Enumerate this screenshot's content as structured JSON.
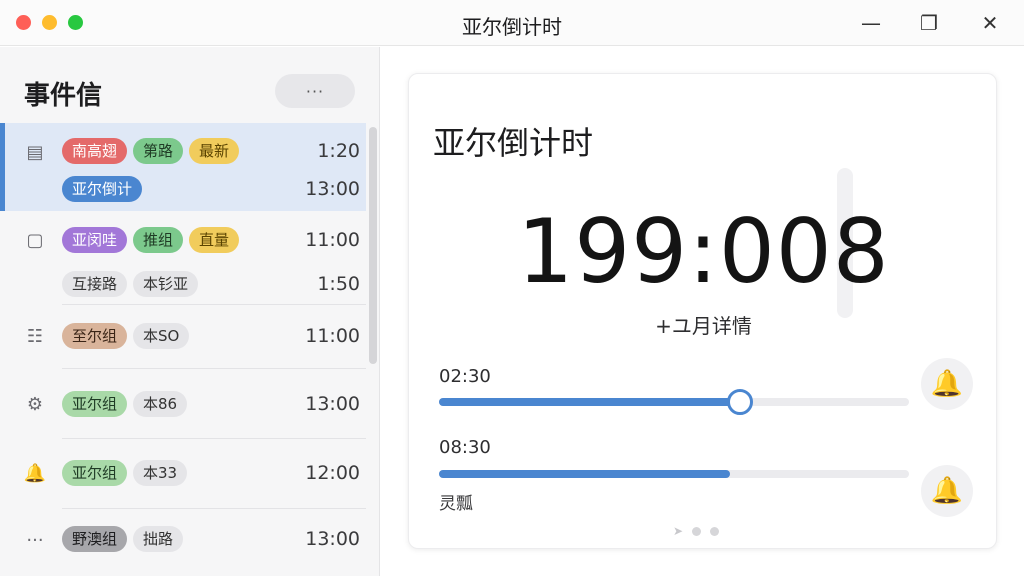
{
  "window": {
    "title": "亚尔倒计时",
    "min_glyph": "—",
    "max_glyph": "❐",
    "close_glyph": "✕"
  },
  "sidebar": {
    "title": "事件信",
    "more_label": "···",
    "events": [
      {
        "icon": "calendar-icon",
        "glyph": "▤",
        "tags": [
          {
            "label": "南高翅",
            "color": "red"
          },
          {
            "label": "第路",
            "color": "green"
          },
          {
            "label": "最新",
            "color": "yellow"
          }
        ],
        "time": "1:20",
        "selected": true,
        "row2": {
          "tags": [
            {
              "label": "亚尔倒计",
              "color": "blue"
            }
          ],
          "time": "13:00"
        }
      },
      {
        "icon": "calendar-icon",
        "glyph": "▢",
        "tags": [
          {
            "label": "亚闵哇",
            "color": "purple"
          },
          {
            "label": "推组",
            "color": "green"
          },
          {
            "label": "直量",
            "color": "yellow"
          }
        ],
        "time": "11:00",
        "row2": {
          "tags": [
            {
              "label": "互接路",
              "color": "gray"
            },
            {
              "label": "本钐亚",
              "color": "gray"
            }
          ],
          "time": "1:50"
        }
      },
      {
        "icon": "list-calendar-icon",
        "glyph": "☷",
        "tags": [
          {
            "label": "至尔组",
            "color": "tan"
          },
          {
            "label": "本SO",
            "color": "gray"
          }
        ],
        "time": "11:00"
      },
      {
        "icon": "gear-icon",
        "glyph": "⚙",
        "tags": [
          {
            "label": "亚尔组",
            "color": "lgreen"
          },
          {
            "label": "本86",
            "color": "gray"
          }
        ],
        "time": "13:00"
      },
      {
        "icon": "bell-icon",
        "glyph": "🔔",
        "tags": [
          {
            "label": "亚尔组",
            "color": "lgreen"
          },
          {
            "label": "本33",
            "color": "gray"
          }
        ],
        "time": "12:00"
      },
      {
        "icon": "more-icon",
        "glyph": "···",
        "tags": [
          {
            "label": "野澳组",
            "color": "dgray"
          },
          {
            "label": "拙路",
            "color": "gray"
          }
        ],
        "time": "13:00"
      }
    ]
  },
  "main": {
    "title": "亚尔倒计时",
    "countdown": "199:008",
    "subtitle": "+ユ月详情",
    "alarms": [
      {
        "time": "02:30",
        "progress": 0.64,
        "has_thumb": true
      },
      {
        "time": "08:30",
        "progress": 0.62,
        "has_thumb": false
      }
    ],
    "note": "灵瓢",
    "bell_glyph": "🔔",
    "arrow_glyph": "➤"
  },
  "colors": {
    "accent": "#4a86d0",
    "bell": "#f2b500",
    "selected_row": "#dfe8f6"
  }
}
